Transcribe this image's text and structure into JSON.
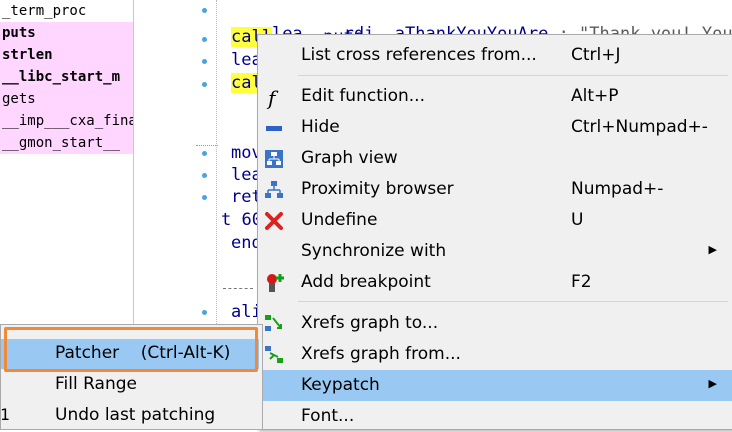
{
  "functions": [
    {
      "name": "_term_proc",
      "pink": false,
      "bold": false
    },
    {
      "name": "puts",
      "pink": true,
      "bold": true
    },
    {
      "name": "strlen",
      "pink": true,
      "bold": true
    },
    {
      "name": "__libc_start_m",
      "pink": true,
      "bold": true
    },
    {
      "name": "gets",
      "pink": true,
      "bold": false
    },
    {
      "name": "__imp___cxa_fina",
      "pink": true,
      "bold": false
    },
    {
      "name": "__gmon_start__",
      "pink": true,
      "bold": false
    }
  ],
  "code": {
    "line1_mnemonic": "lea",
    "line1_operand": "rdi, aThankYouYouAre",
    "line1_comment": "; \"Thank you! You",
    "line2": "call",
    "line2_operand": "_puts",
    "line3": "lea",
    "line4": "call",
    "line5": "mov",
    "line6": "lea",
    "line7": "ret",
    "line8": "t 60",
    "line9": "end",
    "line10": "--",
    "line11": "ali",
    "bottom_left_char": "1"
  },
  "context_menu": {
    "items": [
      {
        "label": "List cross references from...",
        "shortcut": "Ctrl+J",
        "icon": "none"
      },
      {
        "label": "Edit function...",
        "shortcut": "Alt+P",
        "icon": "function-icon"
      },
      {
        "label": "Hide",
        "shortcut": "Ctrl+Numpad+-",
        "icon": "hide-icon"
      },
      {
        "label": "Graph view",
        "shortcut": "",
        "icon": "graph-view-icon"
      },
      {
        "label": "Proximity browser",
        "shortcut": "Numpad+-",
        "icon": "proximity-icon"
      },
      {
        "label": "Undefine",
        "shortcut": "U",
        "icon": "undefine-icon"
      },
      {
        "label": "Synchronize with",
        "shortcut": "",
        "icon": "none"
      },
      {
        "label": "Add breakpoint",
        "shortcut": "F2",
        "icon": "breakpoint-icon"
      },
      {
        "label": "Xrefs graph to...",
        "shortcut": "",
        "icon": "xrefs-to-icon"
      },
      {
        "label": "Xrefs graph from...",
        "shortcut": "",
        "icon": "xrefs-from-icon"
      },
      {
        "label": "Keypatch",
        "shortcut": "",
        "icon": "none"
      },
      {
        "label": "Font...",
        "shortcut": "",
        "icon": "none"
      }
    ],
    "submenu_arrow": "▶"
  },
  "submenu": {
    "items": [
      "Patcher    (Ctrl-Alt-K)",
      "Fill Range",
      "Undo last patching"
    ]
  },
  "colors": {
    "selection": "#99c9f2",
    "highlight_box": "#f08a3a",
    "pink_row": "#ffd6ff",
    "call_highlight": "#ffff40"
  }
}
